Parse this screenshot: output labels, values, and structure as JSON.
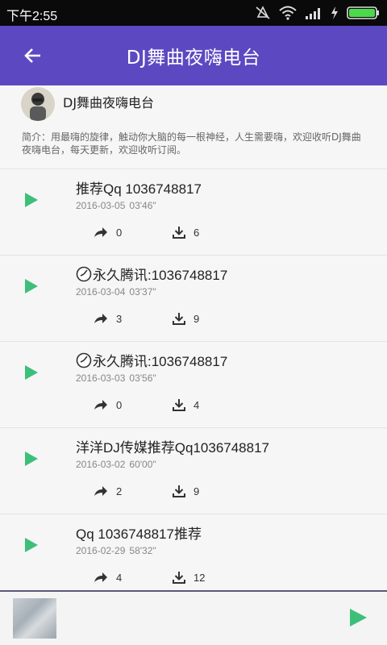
{
  "status": {
    "time": "下午2:55"
  },
  "toolbar": {
    "title": "DJ舞曲夜嗨电台"
  },
  "header": {
    "name": "DJ舞曲夜嗨电台",
    "intro": "简介：用最嗨的旋律，触动你大脑的每一根神经，人生需要嗨，欢迎收听DJ舞曲夜嗨电台，每天更新，欢迎收听订阅。"
  },
  "tracks": [
    {
      "title": "推荐Qq 1036748817",
      "date": "2016-03-05",
      "duration": "03'46\"",
      "shares": "0",
      "downloads": "6"
    },
    {
      "title": "永久腾讯:1036748817",
      "date": "2016-03-04",
      "duration": "03'37\"",
      "shares": "3",
      "downloads": "9"
    },
    {
      "title": "永久腾讯:1036748817",
      "date": "2016-03-03",
      "duration": "03'56\"",
      "shares": "0",
      "downloads": "4"
    },
    {
      "title": "洋洋DJ传媒推荐Qq1036748817",
      "date": "2016-03-02",
      "duration": "60'00\"",
      "shares": "2",
      "downloads": "9"
    },
    {
      "title": "Qq 1036748817推荐",
      "date": "2016-02-29",
      "duration": "58'32\"",
      "shares": "4",
      "downloads": "12"
    }
  ],
  "colors": {
    "toolbar": "#5c49c2",
    "accent_play": "#3dbf7a"
  },
  "icons": [
    "back-arrow-icon",
    "play-icon",
    "share-icon",
    "download-icon",
    "clock-icon",
    "wifi-icon",
    "signal-icon",
    "battery-icon",
    "mute-icon",
    "charging-icon"
  ]
}
